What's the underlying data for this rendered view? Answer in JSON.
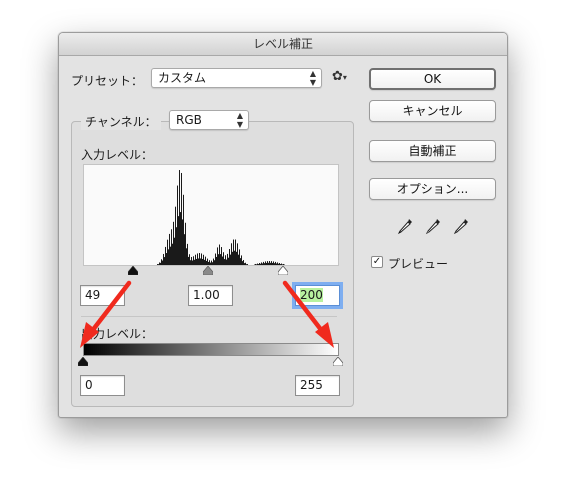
{
  "dialog": {
    "title": "レベル補正"
  },
  "preset": {
    "label": "プリセット：",
    "value": "カスタム"
  },
  "channel": {
    "label": "チャンネル：",
    "value": "RGB"
  },
  "input_levels": {
    "label": "入力レベル：",
    "black": "49",
    "gamma": "1.00",
    "white": "200"
  },
  "output_levels": {
    "label": "出力レベル：",
    "black": "0",
    "white": "255"
  },
  "buttons": {
    "ok": "OK",
    "cancel": "キャンセル",
    "auto": "自動補正",
    "options": "オプション..."
  },
  "preview": {
    "label": "プレビュー",
    "checked": true
  },
  "colors": {
    "dialog_bg": "#e3e3e3",
    "arrow": "#f02a1e",
    "focus_ring": "#7eaef0",
    "highlight": "#b8f2a0"
  }
}
